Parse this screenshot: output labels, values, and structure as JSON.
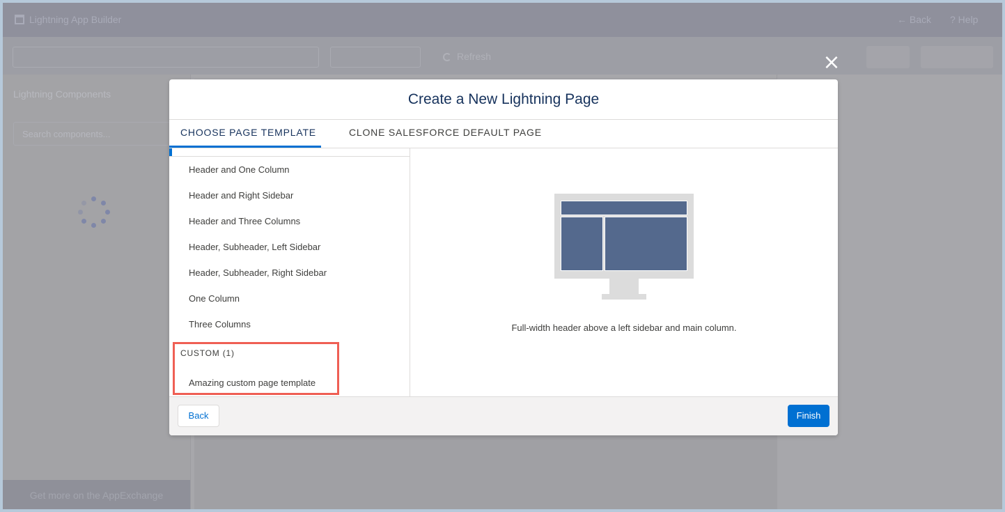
{
  "app": {
    "title": "Lightning App Builder",
    "back_label": "← Back",
    "help_label": "? Help",
    "refresh_label": "Refresh"
  },
  "left_panel": {
    "title": "Lightning Components",
    "search_placeholder": "Search components...",
    "footer_link": "Get more on the AppExchange"
  },
  "modal": {
    "close_icon": "×",
    "title": "Create a New Lightning Page",
    "tabs": [
      {
        "label": "CHOOSE PAGE TEMPLATE",
        "active": true
      },
      {
        "label": "CLONE SALESFORCE DEFAULT PAGE",
        "active": false
      }
    ],
    "templates": [
      "Header and One Column",
      "Header and Right Sidebar",
      "Header and Three Columns",
      "Header, Subheader, Left Sidebar",
      "Header, Subheader, Right Sidebar",
      "One Column",
      "Three Columns"
    ],
    "custom_section": {
      "heading": "CUSTOM (1)",
      "items": [
        "Amazing custom page template"
      ]
    },
    "preview": {
      "icon": "monitor-layout-icon",
      "description": "Full-width header above a left sidebar and main column."
    },
    "footer": {
      "back_label": "Back",
      "finish_label": "Finish"
    }
  },
  "colors": {
    "brand": "#0070d2",
    "title_text": "#16325c",
    "highlight_box": "#ef5f54",
    "preview_fill": "#54698d"
  }
}
